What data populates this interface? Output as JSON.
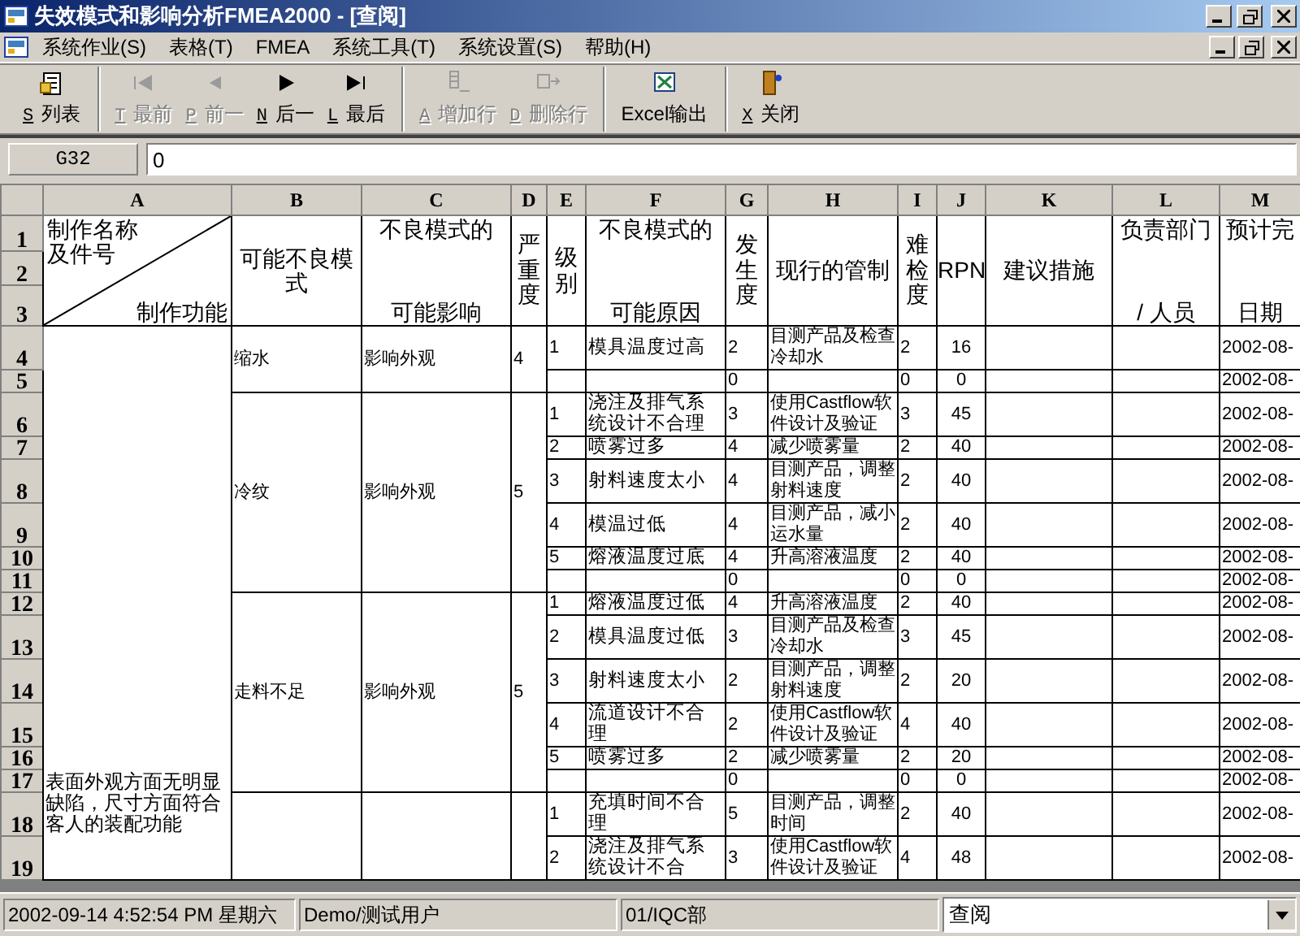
{
  "window": {
    "title": "失效模式和影响分析FMEA2000 - [查阅]"
  },
  "menu": [
    "系统作业(S)",
    "表格(T)",
    "FMEA",
    "系统工具(T)",
    "系统设置(S)",
    "帮助(H)"
  ],
  "toolbar": [
    [
      {
        "key": "S",
        "label": "列表",
        "disabled": false
      }
    ],
    [
      {
        "key": "T",
        "label": "最前",
        "disabled": true
      },
      {
        "key": "P",
        "label": "前一",
        "disabled": true
      },
      {
        "key": "N",
        "label": "后一",
        "disabled": false
      },
      {
        "key": "L",
        "label": "最后",
        "disabled": false
      }
    ],
    [
      {
        "key": "A",
        "label": "增加行",
        "disabled": true
      },
      {
        "key": "D",
        "label": "删除行",
        "disabled": true
      }
    ],
    [
      {
        "label": "Excel输出",
        "disabled": false
      }
    ],
    [
      {
        "key": "X",
        "label": "关闭",
        "disabled": false
      }
    ]
  ],
  "formula_bar": {
    "cell": "G32",
    "value": "0"
  },
  "sheet": {
    "columns": [
      "A",
      "B",
      "C",
      "D",
      "E",
      "F",
      "G",
      "H",
      "I",
      "J",
      "K",
      "L",
      "M"
    ],
    "header": {
      "row_numbers": [
        "1",
        "2",
        "3"
      ],
      "cells": [
        {
          "kind": "diagonal",
          "top": "制作名称",
          "top_2": "及件号",
          "bottom": "制作功能"
        },
        {
          "kind": "center",
          "text": "可能不良模式"
        },
        {
          "kind": "split",
          "top": "不良模式的",
          "bottom": "可能影响"
        },
        {
          "kind": "vertical",
          "text": "严重度"
        },
        {
          "kind": "vertical",
          "text": "级别"
        },
        {
          "kind": "split",
          "top": "不良模式的",
          "bottom": "可能原因"
        },
        {
          "kind": "vertical",
          "text": "发生度"
        },
        {
          "kind": "center",
          "text": "现行的管制"
        },
        {
          "kind": "vertical",
          "text": "难检度"
        },
        {
          "kind": "center",
          "text": "RPN"
        },
        {
          "kind": "center",
          "text": "建议措施"
        },
        {
          "kind": "split",
          "top": "负责部门",
          "bottom": "/ 人员"
        },
        {
          "kind": "split",
          "top": "预计完",
          "bottom": "日期"
        }
      ]
    },
    "part_function": "表面外观方面无明显缺陷，尺寸方面符合客人的装配功能",
    "modes": [
      {
        "mode": "缩水",
        "effect": "影响外观",
        "severity": "4",
        "rows": [
          {
            "number": "4",
            "grade": "1",
            "cause": "模具温度过高",
            "occurrence": "2",
            "control": "目测产品及检查冷却水",
            "detection": "2",
            "rpn": "16",
            "date": "2002-08-"
          },
          {
            "number": "5",
            "occurrence": "0",
            "detection": "0",
            "rpn": "0",
            "date": "2002-08-"
          }
        ]
      },
      {
        "mode": "冷纹",
        "effect": "影响外观",
        "severity": "5",
        "rows": [
          {
            "number": "6",
            "grade": "1",
            "cause": "浇注及排气系统设计不合理",
            "occurrence": "3",
            "control": "使用Castflow软件设计及验证",
            "detection": "3",
            "rpn": "45",
            "date": "2002-08-"
          },
          {
            "number": "7",
            "grade": "2",
            "cause": "喷雾过多",
            "occurrence": "4",
            "control": "减少喷雾量",
            "detection": "2",
            "rpn": "40",
            "date": "2002-08-"
          },
          {
            "number": "8",
            "grade": "3",
            "cause": "射料速度太小",
            "occurrence": "4",
            "control": "目测产品，调整射料速度",
            "detection": "2",
            "rpn": "40",
            "date": "2002-08-"
          },
          {
            "number": "9",
            "grade": "4",
            "cause": "模温过低",
            "occurrence": "4",
            "control": "目测产品，减小运水量",
            "detection": "2",
            "rpn": "40",
            "date": "2002-08-"
          },
          {
            "number": "10",
            "grade": "5",
            "cause": "熔液温度过底",
            "occurrence": "4",
            "control": "升高溶液温度",
            "detection": "2",
            "rpn": "40",
            "date": "2002-08-"
          },
          {
            "number": "11",
            "occurrence": "0",
            "detection": "0",
            "rpn": "0",
            "date": "2002-08-"
          }
        ]
      },
      {
        "mode": "走料不足",
        "effect": "影响外观",
        "severity": "5",
        "rows": [
          {
            "number": "12",
            "grade": "1",
            "cause": "熔液温度过低",
            "occurrence": "4",
            "control": "升高溶液温度",
            "detection": "2",
            "rpn": "40",
            "date": "2002-08-"
          },
          {
            "number": "13",
            "grade": "2",
            "cause": "模具温度过低",
            "occurrence": "3",
            "control": "目测产品及检查冷却水",
            "detection": "3",
            "rpn": "45",
            "date": "2002-08-"
          },
          {
            "number": "14",
            "grade": "3",
            "cause": "射料速度太小",
            "occurrence": "2",
            "control": "目测产品，调整射料速度",
            "detection": "2",
            "rpn": "20",
            "date": "2002-08-"
          },
          {
            "number": "15",
            "grade": "4",
            "cause": "流道设计不合理",
            "occurrence": "2",
            "control": "使用Castflow软件设计及验证",
            "detection": "4",
            "rpn": "40",
            "date": "2002-08-"
          },
          {
            "number": "16",
            "grade": "5",
            "cause": "喷雾过多",
            "occurrence": "2",
            "control": "减少喷雾量",
            "detection": "2",
            "rpn": "20",
            "date": "2002-08-"
          },
          {
            "number": "17",
            "occurrence": "0",
            "detection": "0",
            "rpn": "0",
            "date": "2002-08-"
          }
        ]
      },
      {
        "rows": [
          {
            "number": "18",
            "grade": "1",
            "cause": "充填时间不合理",
            "occurrence": "5",
            "control": "目测产品，调整时间",
            "detection": "2",
            "rpn": "40",
            "date": "2002-08-"
          },
          {
            "number": "19",
            "grade": "2",
            "cause": "浇注及排气系统设计不合",
            "occurrence": "3",
            "control": "使用Castflow软件设计及验证",
            "detection": "4",
            "rpn": "48",
            "date": "2002-08-"
          }
        ]
      }
    ]
  },
  "status_bar": {
    "datetime": "2002-09-14 4:52:54 PM  星期六",
    "user": "Demo/测试用户",
    "department": "01/IQC部",
    "mode": "查阅"
  }
}
